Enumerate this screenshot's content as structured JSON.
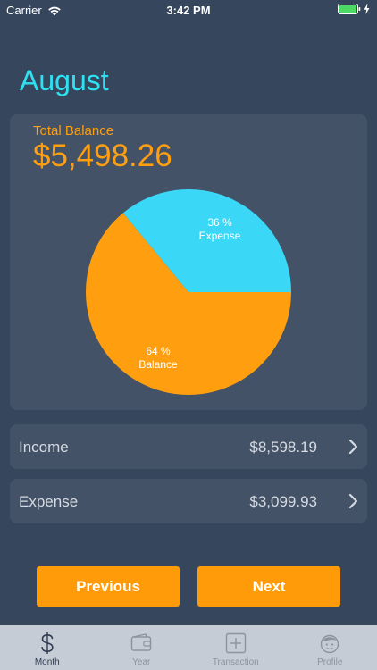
{
  "status_bar": {
    "carrier": "Carrier",
    "time": "3:42 PM"
  },
  "header": {
    "title": "August"
  },
  "balance_card": {
    "label": "Total Balance",
    "value": "$5,498.26"
  },
  "chart_data": {
    "type": "pie",
    "slices": [
      {
        "percent_text": "36 %",
        "label": "Expense",
        "value": 36,
        "color": "#3ad7f7"
      },
      {
        "percent_text": "64 %",
        "label": "Balance",
        "value": 64,
        "color": "#ff9f0f"
      }
    ]
  },
  "rows": {
    "income": {
      "label": "Income",
      "value": "$8,598.19"
    },
    "expense": {
      "label": "Expense",
      "value": "$3,099.93"
    }
  },
  "buttons": {
    "previous": "Previous",
    "next": "Next"
  },
  "tabs": [
    {
      "label": "Month",
      "icon": "dollar-icon",
      "active": true
    },
    {
      "label": "Year",
      "icon": "wallet-icon",
      "active": false
    },
    {
      "label": "Transaction",
      "icon": "plus-square-icon",
      "active": false
    },
    {
      "label": "Profile",
      "icon": "face-icon",
      "active": false
    }
  ],
  "colors": {
    "background": "#36465c",
    "card": "#445267",
    "accent_orange": "#ff9f0f",
    "accent_cyan": "#2fe0f2",
    "tabbar": "#c5ccd6"
  }
}
